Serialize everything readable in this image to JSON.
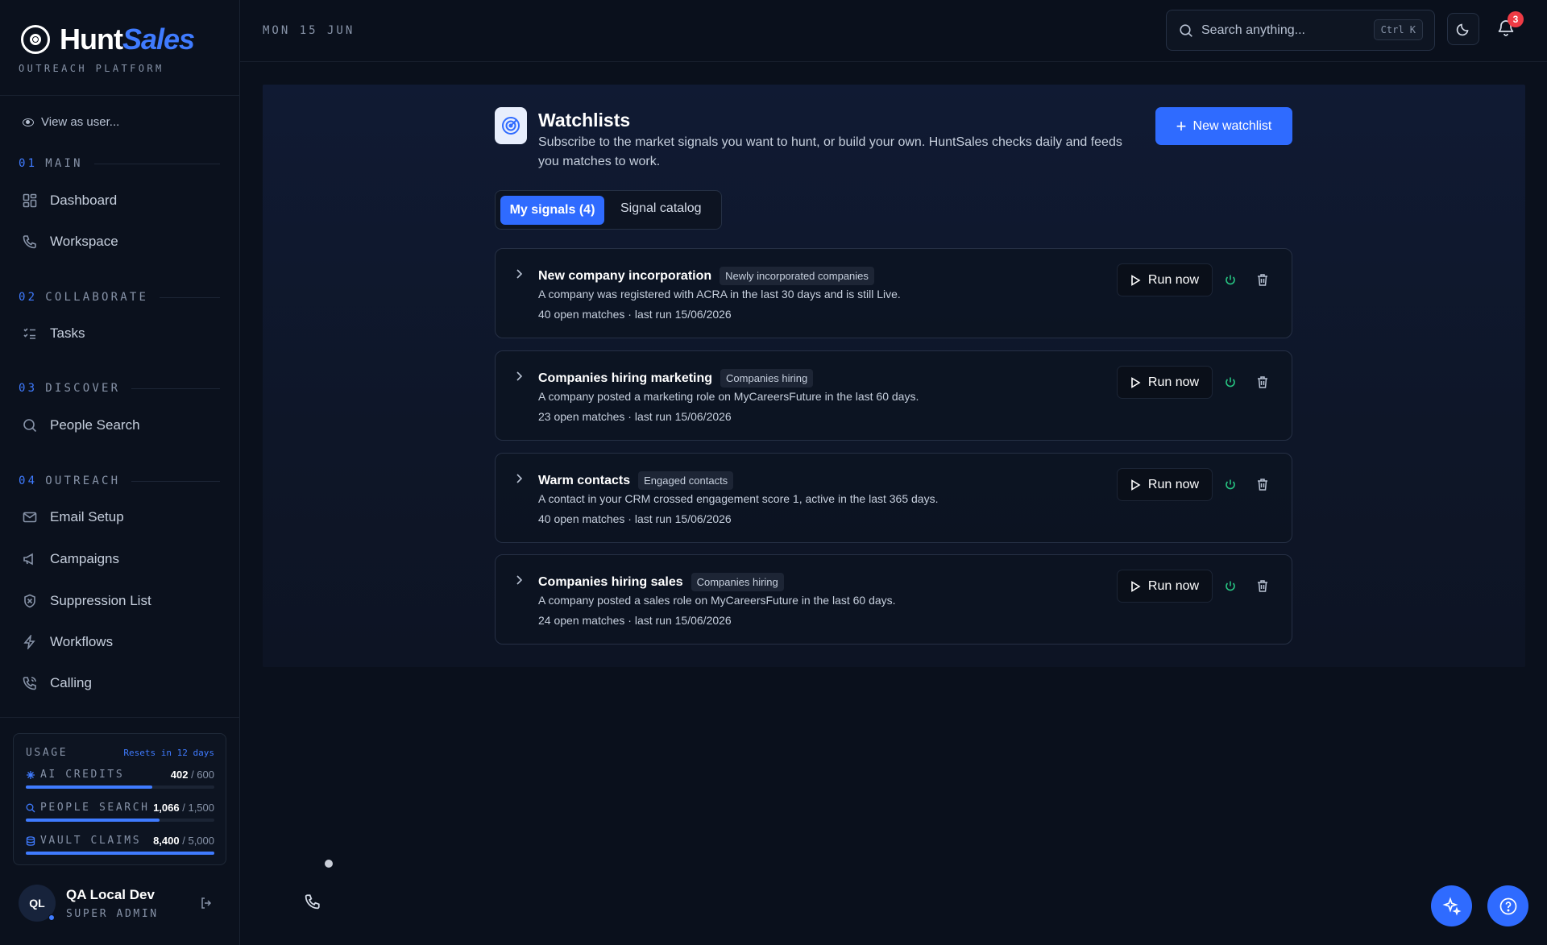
{
  "brand": {
    "name_main": "Hunt",
    "name_accent": "Sales",
    "subtitle": "OUTREACH PLATFORM"
  },
  "sidebar": {
    "view_as": "View as user...",
    "sections": [
      {
        "num": "01",
        "label": "MAIN"
      },
      {
        "num": "02",
        "label": "COLLABORATE"
      },
      {
        "num": "03",
        "label": "DISCOVER"
      },
      {
        "num": "04",
        "label": "OUTREACH"
      }
    ],
    "items": {
      "dashboard": "Dashboard",
      "workspace": "Workspace",
      "tasks": "Tasks",
      "people_search": "People Search",
      "email_setup": "Email Setup",
      "campaigns": "Campaigns",
      "suppression_list": "Suppression List",
      "workflows": "Workflows",
      "calling": "Calling"
    }
  },
  "usage": {
    "title": "USAGE",
    "resets": "Resets in 12 days",
    "rows": [
      {
        "label": "AI CREDITS",
        "used": "402",
        "total": "/ 600",
        "fraction": 0.67
      },
      {
        "label": "PEOPLE SEARCH",
        "used": "1,066",
        "total": "/ 1,500",
        "fraction": 0.71
      },
      {
        "label": "VAULT CLAIMS",
        "used": "8,400",
        "total": "/ 5,000",
        "fraction": 1.0
      }
    ]
  },
  "user": {
    "initials": "QL",
    "name": "QA Local Dev",
    "role": "SUPER ADMIN"
  },
  "topbar": {
    "date": "MON 15 JUN",
    "search_placeholder": "Search anything...",
    "shortcut": "Ctrl K",
    "notifications": "3"
  },
  "watchlists": {
    "title": "Watchlists",
    "description": "Subscribe to the market signals you want to hunt, or build your own. HuntSales checks daily and feeds you matches to work.",
    "new_button": "New watchlist",
    "tabs": {
      "active": "My signals (4)",
      "other": "Signal catalog"
    },
    "run_label": "Run now",
    "signals": [
      {
        "title": "New company incorporation",
        "tag": "Newly incorporated companies",
        "desc": "A company was registered with ACRA in the last 30 days and is still Live.",
        "meta": "40 open matches · last run 15/06/2026"
      },
      {
        "title": "Companies hiring marketing",
        "tag": "Companies hiring",
        "desc": "A company posted a marketing role on MyCareersFuture in the last 60 days.",
        "meta": "23 open matches · last run 15/06/2026"
      },
      {
        "title": "Warm contacts",
        "tag": "Engaged contacts",
        "desc": "A contact in your CRM crossed engagement score 1, active in the last 365 days.",
        "meta": "40 open matches · last run 15/06/2026"
      },
      {
        "title": "Companies hiring sales",
        "tag": "Companies hiring",
        "desc": "A company posted a sales role on MyCareersFuture in the last 60 days.",
        "meta": "24 open matches · last run 15/06/2026"
      }
    ]
  },
  "colors": {
    "accent": "#2f6bff",
    "background": "#0a101c",
    "badge": "#ef3b45",
    "power": "#27c281"
  }
}
